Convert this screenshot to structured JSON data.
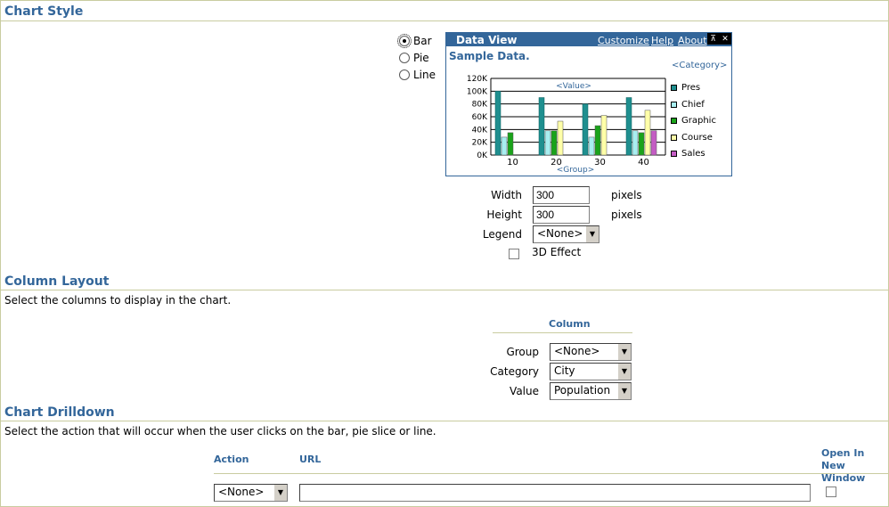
{
  "chart_style": {
    "title": "Chart Style",
    "radios": [
      {
        "label": "Bar",
        "selected": true
      },
      {
        "label": "Pie",
        "selected": false
      },
      {
        "label": "Line",
        "selected": false
      }
    ],
    "data_view": {
      "title": "Data View",
      "links": [
        "Customize",
        "Help",
        "About"
      ],
      "sample_label": "Sample Data.",
      "category_label": "<Category>",
      "value_label": "<Value>",
      "group_label": "<Group>"
    },
    "width_label": "Width",
    "width_value": "300",
    "height_label": "Height",
    "height_value": "300",
    "units": "pixels",
    "legend_label": "Legend",
    "legend_value": "<None>",
    "effect_label": "3D Effect"
  },
  "chart_data": {
    "type": "bar",
    "categories": [
      "10",
      "20",
      "30",
      "40"
    ],
    "series": [
      {
        "name": "Pres",
        "values": [
          100000,
          0,
          0,
          0
        ]
      },
      {
        "name": "Chief",
        "values": [
          28000,
          38000,
          28000,
          38000
        ]
      },
      {
        "name": "Graphic",
        "values": [
          35000,
          38000,
          46000,
          35000
        ]
      },
      {
        "name": "Course",
        "values": [
          0,
          53000,
          62000,
          70000
        ]
      },
      {
        "name": "Sales",
        "values": [
          0,
          0,
          0,
          38000
        ]
      }
    ],
    "extra_bars": [
      {
        "category": "20",
        "value": 90000
      },
      {
        "category": "30",
        "value": 80000
      },
      {
        "category": "40",
        "value": 90000
      }
    ],
    "ylim": [
      0,
      120000
    ],
    "yticks": [
      "120K",
      "100K",
      "80K",
      "60K",
      "40K",
      "20K",
      "0K"
    ],
    "colors": {
      "Pres": "#1f8f8f",
      "Chief": "#a8eef0",
      "Graphic": "#1aa31a",
      "Course": "#ffffa8",
      "Sales": "#c45cc4"
    }
  },
  "column_layout": {
    "title": "Column Layout",
    "description": "Select the columns to display in the chart.",
    "column_header": "Column",
    "rows": [
      {
        "label": "Group",
        "value": "<None>"
      },
      {
        "label": "Category",
        "value": "City"
      },
      {
        "label": "Value",
        "value": "Population"
      }
    ]
  },
  "drilldown": {
    "title": "Chart Drilldown",
    "description": "Select the action that will occur when the user clicks on the bar, pie slice or line.",
    "headers": {
      "action": "Action",
      "url": "URL",
      "new_window": "Open In New Window"
    },
    "action_value": "<None>",
    "url_value": ""
  }
}
